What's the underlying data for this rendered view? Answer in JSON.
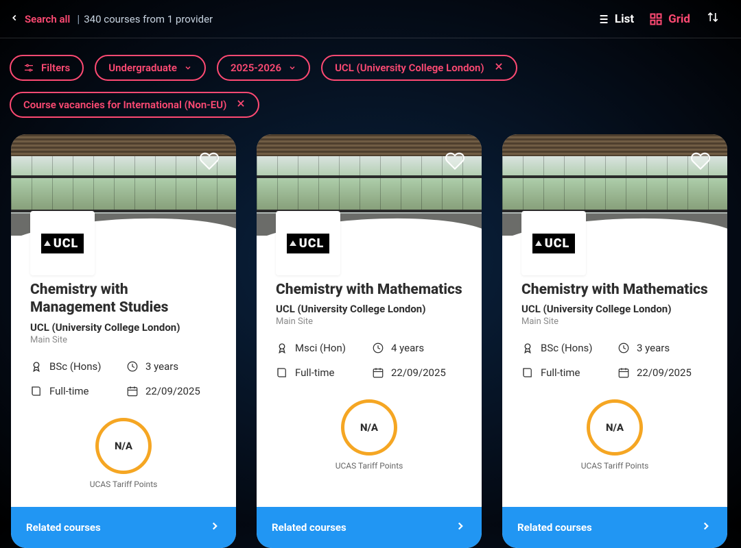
{
  "header": {
    "search_all": "Search all",
    "count_text": "340 courses from 1 provider",
    "list_label": "List",
    "grid_label": "Grid"
  },
  "filters": {
    "filters_label": "Filters",
    "level": "Undergraduate",
    "year": "2025-2026",
    "provider": "UCL (University College London)",
    "vacancy": "Course vacancies for International (Non-EU)"
  },
  "tariff_label": "UCAS Tariff Points",
  "related_label": "Related courses",
  "logo_text": "UCL",
  "cards": [
    {
      "title": "Chemistry with Management Studies",
      "provider": "UCL (University College London)",
      "site": "Main Site",
      "qual": "BSc (Hons)",
      "duration": "3 years",
      "mode": "Full-time",
      "start": "22/09/2025",
      "tariff": "N/A"
    },
    {
      "title": "Chemistry with Mathematics",
      "provider": "UCL (University College London)",
      "site": "Main Site",
      "qual": "Msci (Hon)",
      "duration": "4 years",
      "mode": "Full-time",
      "start": "22/09/2025",
      "tariff": "N/A"
    },
    {
      "title": "Chemistry with Mathematics",
      "provider": "UCL (University College London)",
      "site": "Main Site",
      "qual": "BSc (Hons)",
      "duration": "3 years",
      "mode": "Full-time",
      "start": "22/09/2025",
      "tariff": "N/A"
    }
  ]
}
